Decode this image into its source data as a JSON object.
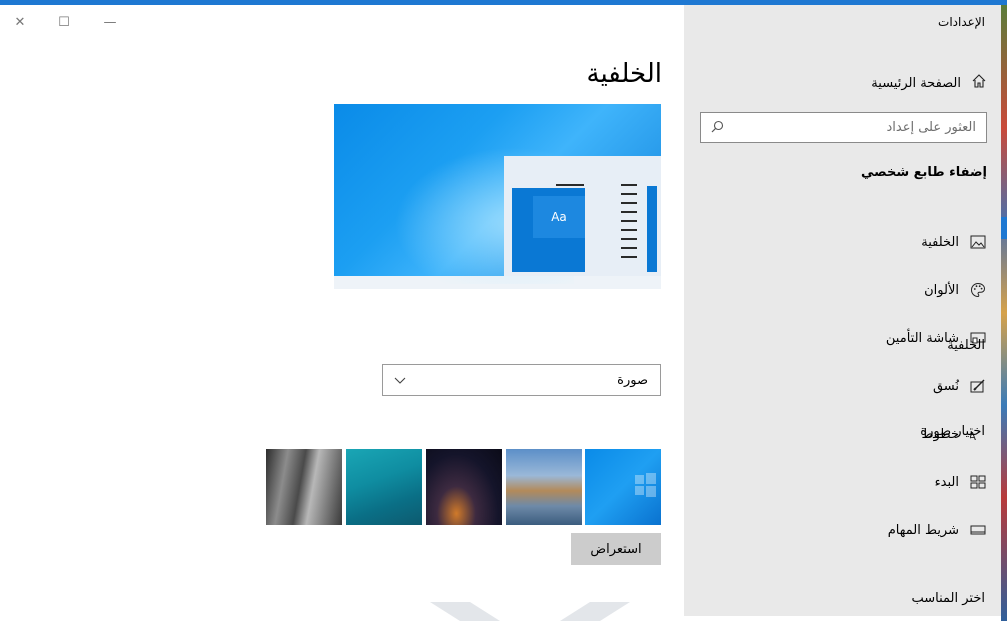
{
  "window": {
    "title": "الإعدادات",
    "controls": {
      "close": "✕",
      "maximize": "☐",
      "minimize": "—"
    }
  },
  "sidebar": {
    "home_label": "الصفحة الرئيسية",
    "search_placeholder": "العثور على إعداد",
    "section_heading": "إضفاء طابع شخصي",
    "items": [
      {
        "label": "الخلفية",
        "icon": "image-icon",
        "selected": true
      },
      {
        "label": "الألوان",
        "icon": "palette-icon",
        "selected": false
      },
      {
        "label": "شاشة التأمين",
        "icon": "lock-screen-icon",
        "selected": false
      },
      {
        "label": "نُسق",
        "icon": "themes-icon",
        "selected": false
      },
      {
        "label": "خطوط",
        "icon": "fonts-icon",
        "selected": false
      },
      {
        "label": "البدء",
        "icon": "start-icon",
        "selected": false
      },
      {
        "label": "شريط المهام",
        "icon": "taskbar-icon",
        "selected": false
      }
    ]
  },
  "main": {
    "title": "الخلفية",
    "preview": {
      "sample_text": "Aa"
    },
    "background_label": "الخلفية",
    "background_dropdown": {
      "selected": "صورة"
    },
    "choose_picture_label": "اختيار صورة",
    "thumbnails": [
      {
        "name": "gray-rock-wallpaper"
      },
      {
        "name": "underwater-swimmer-wallpaper"
      },
      {
        "name": "night-sky-tent-wallpaper"
      },
      {
        "name": "beach-rocks-wallpaper"
      },
      {
        "name": "windows-blue-wallpaper"
      }
    ],
    "browse_button": "استعراض",
    "fit_label": "اختر المناسب"
  },
  "colors": {
    "accent": "#0a78d4",
    "sidebar_bg": "#e9e9e9",
    "button_bg": "#cccccc"
  }
}
